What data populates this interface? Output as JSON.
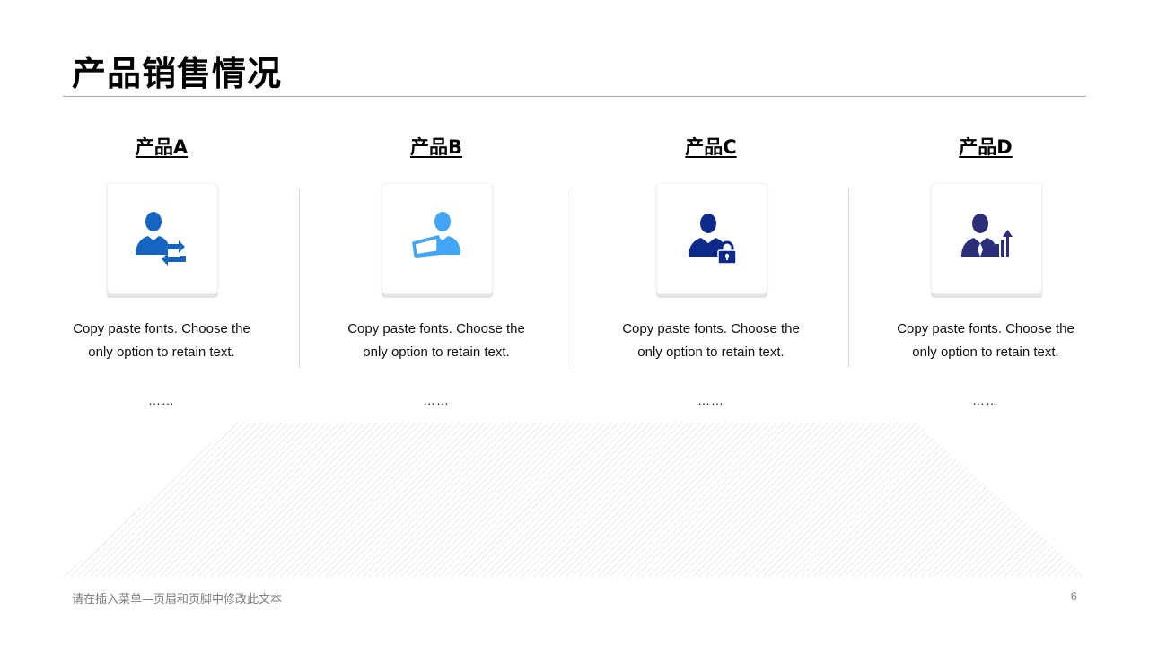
{
  "slide": {
    "title": "产品销售情况",
    "footer_text": "请在插入菜单—页眉和页脚中修改此文本",
    "page_number": "6"
  },
  "products": [
    {
      "name": "产品A",
      "icon": "user-sync-icon",
      "color": "#1565c0",
      "desc_line1": "Copy paste fonts. Choose the",
      "desc_line2": "only option to retain text.",
      "more": "……"
    },
    {
      "name": "产品B",
      "icon": "user-laptop-icon",
      "color": "#42a5f5",
      "desc_line1": "Copy paste fonts. Choose the",
      "desc_line2": "only option to retain text.",
      "more": "……"
    },
    {
      "name": "产品C",
      "icon": "user-lock-icon",
      "color": "#0d2a8a",
      "desc_line1": "Copy paste fonts. Choose the",
      "desc_line2": "only option to retain text.",
      "more": "……"
    },
    {
      "name": "产品D",
      "icon": "user-chart-icon",
      "color": "#2b2f7a",
      "desc_line1": "Copy paste fonts. Choose the",
      "desc_line2": "only option to retain text.",
      "more": "……"
    }
  ]
}
